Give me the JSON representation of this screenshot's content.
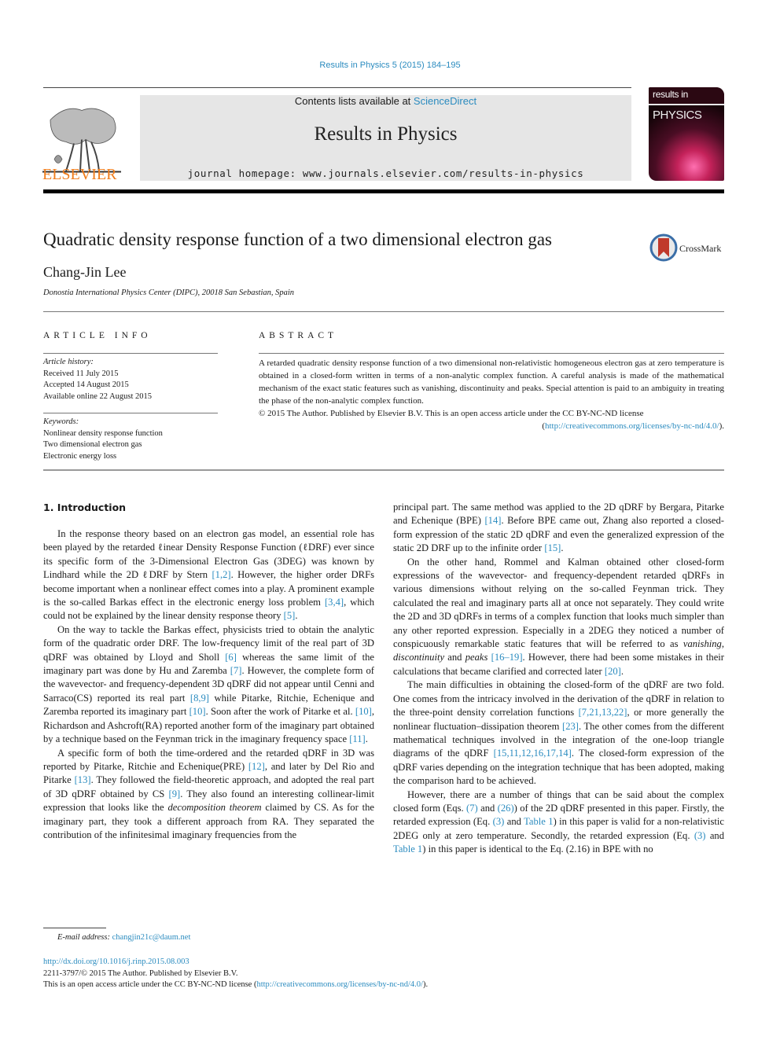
{
  "header": {
    "citation": "Results in Physics 5 (2015) 184–195",
    "publisher_logo": "ELSEVIER",
    "contents_prefix": "Contents lists available at ",
    "contents_link": "ScienceDirect",
    "journal_title": "Results in Physics",
    "homepage_prefix": "journal homepage: ",
    "homepage_url": "www.journals.elsevier.com/results-in-physics",
    "cover": {
      "line1": "results in",
      "line2": "PHYSICS"
    }
  },
  "article": {
    "title": "Quadratic density response function of a two dimensional electron gas",
    "crossmark_label": "CrossMark",
    "author": "Chang-Jin Lee",
    "affiliation": "Donostia International Physics Center (DIPC), 20018 San Sebastian, Spain"
  },
  "article_info": {
    "heading": "ARTICLE INFO",
    "history_label": "Article history:",
    "history": [
      "Received 11 July 2015",
      "Accepted 14 August 2015",
      "Available online 22 August 2015"
    ],
    "keywords_label": "Keywords:",
    "keywords": [
      "Nonlinear density response function",
      "Two dimensional electron gas",
      "Electronic energy loss"
    ]
  },
  "abstract": {
    "heading": "ABSTRACT",
    "text": "A retarded quadratic density response function of a two dimensional non-relativistic homogeneous electron gas at zero temperature is obtained in a closed-form written in terms of a non-analytic complex function. A careful analysis is made of the mathematical mechanism of the exact static features such as vanishing, discontinuity and peaks. Special attention is paid to an ambiguity in treating the phase of the non-analytic complex function.",
    "copyright": "© 2015 The Author. Published by Elsevier B.V. This is an open access article under the CC BY-NC-ND license",
    "license_link": "http://creativecommons.org/licenses/by-nc-nd/4.0/"
  },
  "body": {
    "section_heading": "1. Introduction",
    "left_column": {
      "p1": [
        "In the response theory based on an electron gas model, an essential role has been played by the retarded ℓinear Density Response Function (ℓDRF) ever since its specific form of the 3-Dimensional Electron Gas (3DEG) was known by Lindhard while the 2D ℓDRF by Stern ",
        "[1,2]",
        ". However, the higher order DRFs become important when a nonlinear effect comes into a play. A prominent example is the so-called Barkas effect in the electronic energy loss problem ",
        "[3,4]",
        ", which could not be explained by the linear density response theory ",
        "[5]",
        "."
      ],
      "p2": [
        "On the way to tackle the Barkas effect, physicists tried to obtain the analytic form of the quadratic order DRF. The low-frequency limit of the real part of 3D qDRF was obtained by Lloyd and Sholl ",
        "[6]",
        " whereas the same limit of the imaginary part was done by Hu and Zaremba ",
        "[7]",
        ". However, the complete form of the wavevector- and frequency-dependent 3D qDRF did not appear until Cenni and Sarraco(CS) reported its real part ",
        "[8,9]",
        " while Pitarke, Ritchie, Echenique and Zaremba reported its imaginary part ",
        "[10]",
        ". Soon after the work of Pitarke et al. ",
        "[10]",
        ", Richardson and Ashcroft(RA) reported another form of the imaginary part obtained by a technique based on the Feynman trick in the imaginary frequency space ",
        "[11]",
        "."
      ],
      "p3": [
        "A specific form of both the time-ordered and the retarded qDRF in 3D was reported by Pitarke, Ritchie and Echenique(PRE) ",
        "[12]",
        ", and later by Del Rio and Pitarke ",
        "[13]",
        ". They followed the field-theoretic approach, and adopted the real part of 3D qDRF obtained by CS ",
        "[9]",
        ". They also found an interesting collinear-limit expression that looks like the ",
        "decomposition theorem",
        " claimed by CS. As for the imaginary part, they took a different approach from RA. They separated the contribution of the infinitesimal imaginary frequencies from the"
      ]
    },
    "right_column": {
      "p1": [
        "principal part. The same method was applied to the 2D qDRF by Bergara, Pitarke and Echenique (BPE) ",
        "[14]",
        ". Before BPE came out, Zhang also reported a closed-form expression of the static 2D qDRF and even the generalized expression of the static 2D DRF up to the infinite order ",
        "[15]",
        "."
      ],
      "p2": [
        "On the other hand, Rommel and Kalman obtained other closed-form expressions of the wavevector- and frequency-dependent retarded qDRFs in various dimensions without relying on the so-called Feynman trick. They calculated the real and imaginary parts all at once not separately. They could write the 2D and 3D qDRFs in terms of a complex function that looks much simpler than any other reported expression. Especially in a 2DEG they noticed a number of conspicuously remarkable static features that will be referred to as ",
        "vanishing",
        ", ",
        "discontinuity",
        " and ",
        "peaks",
        " ",
        "[16–19]",
        ". However, there had been some mistakes in their calculations that became clarified and corrected later ",
        "[20]",
        "."
      ],
      "p3": [
        "The main difficulties in obtaining the closed-form of the qDRF are two fold. One comes from the intricacy involved in the derivation of the qDRF in relation to the three-point density correlation functions ",
        "[7,21,13,22]",
        ", or more generally the nonlinear fluctuation–dissipation theorem ",
        "[23]",
        ". The other comes from the different mathematical techniques involved in the integration of the one-loop triangle diagrams of the qDRF ",
        "[15,11,12,16,17,14]",
        ". The closed-form expression of the qDRF varies depending on the integration technique that has been adopted, making the comparison hard to be achieved."
      ],
      "p4": [
        "However, there are a number of things that can be said about the complex closed form (Eqs. ",
        "(7)",
        " and ",
        "(26)",
        ") of the 2D qDRF presented in this paper. Firstly, the retarded expression (Eq. ",
        "(3)",
        " and ",
        "Table 1",
        ") in this paper is valid for a non-relativistic 2DEG only at zero temperature. Secondly, the retarded expression (Eq. ",
        "(3)",
        " and ",
        "Table 1",
        ") in this paper is identical to the Eq. (2.16) in BPE with no"
      ]
    }
  },
  "footnote": {
    "label": "E-mail address: ",
    "email": "changjin21c@daum.net"
  },
  "footer": {
    "doi": "http://dx.doi.org/10.1016/j.rinp.2015.08.003",
    "issn_line": "2211-3797/© 2015 The Author. Published by Elsevier B.V.",
    "license_prefix": "This is an open access article under the CC BY-NC-ND license (",
    "license_link": "http://creativecommons.org/licenses/by-nc-nd/4.0/",
    "license_suffix": ")."
  },
  "colors": {
    "link": "#2a8bbf",
    "elsevier_orange": "#f07c1a",
    "band_grey": "#e6e6e6"
  }
}
